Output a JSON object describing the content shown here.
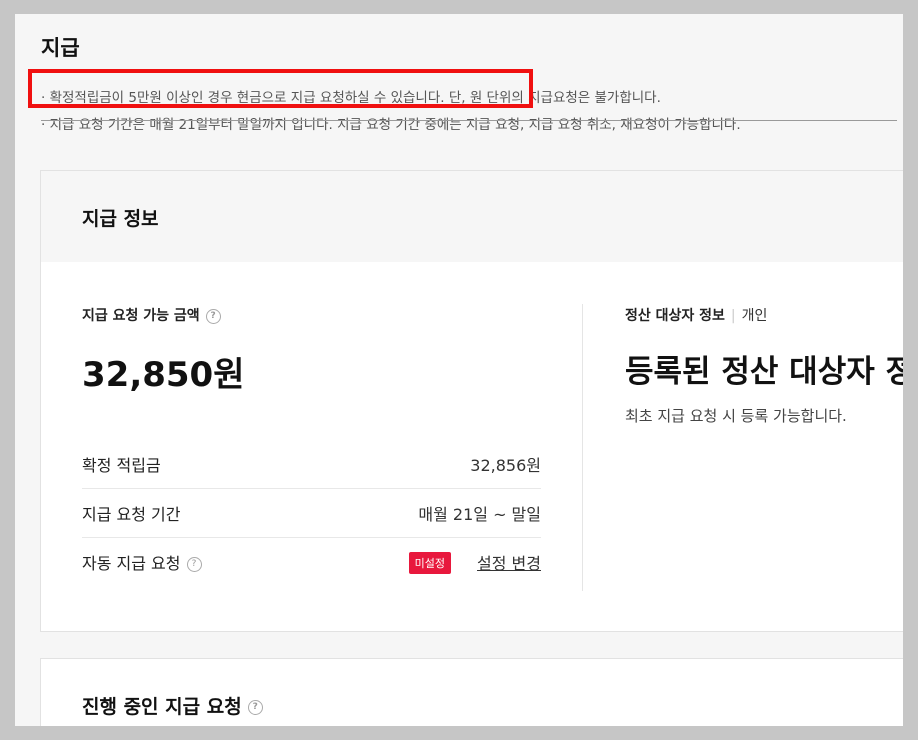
{
  "page": {
    "title": "지급"
  },
  "notices": {
    "line1": "· 확정적립금이 5만원 이상인 경우 현금으로 지급 요청하실 수 있습니다. 단, 원 단위의 지급요청은 불가합니다.",
    "line2": "· 지급 요청 기간은 매월 21일부터 말일까지 입니다. 지급 요청 기간 중에는 지급 요청, 지급 요청 취소, 재요청이 가능합니다."
  },
  "info_card": {
    "title": "지급 정보",
    "available": {
      "label": "지급 요청 가능 금액",
      "amount": "32,850원"
    },
    "rows": [
      {
        "label": "확정 적립금",
        "value": "32,856원"
      },
      {
        "label": "지급 요청 기간",
        "value": "매월 21일 ~ 말일"
      },
      {
        "label": "자동 지급 요청",
        "badge": "미설정",
        "link": "설정 변경"
      }
    ],
    "settlement": {
      "label": "정산 대상자 정보",
      "type": "개인",
      "title": "등록된 정산 대상자 정보가 없습니다",
      "desc": "최초 지급 요청 시 등록 가능합니다."
    }
  },
  "progress_card": {
    "title": "진행 중인 지급 요청"
  },
  "help_icon_glyph": "?",
  "colors": {
    "badge": "#e8183d",
    "highlight": "#f01010"
  }
}
